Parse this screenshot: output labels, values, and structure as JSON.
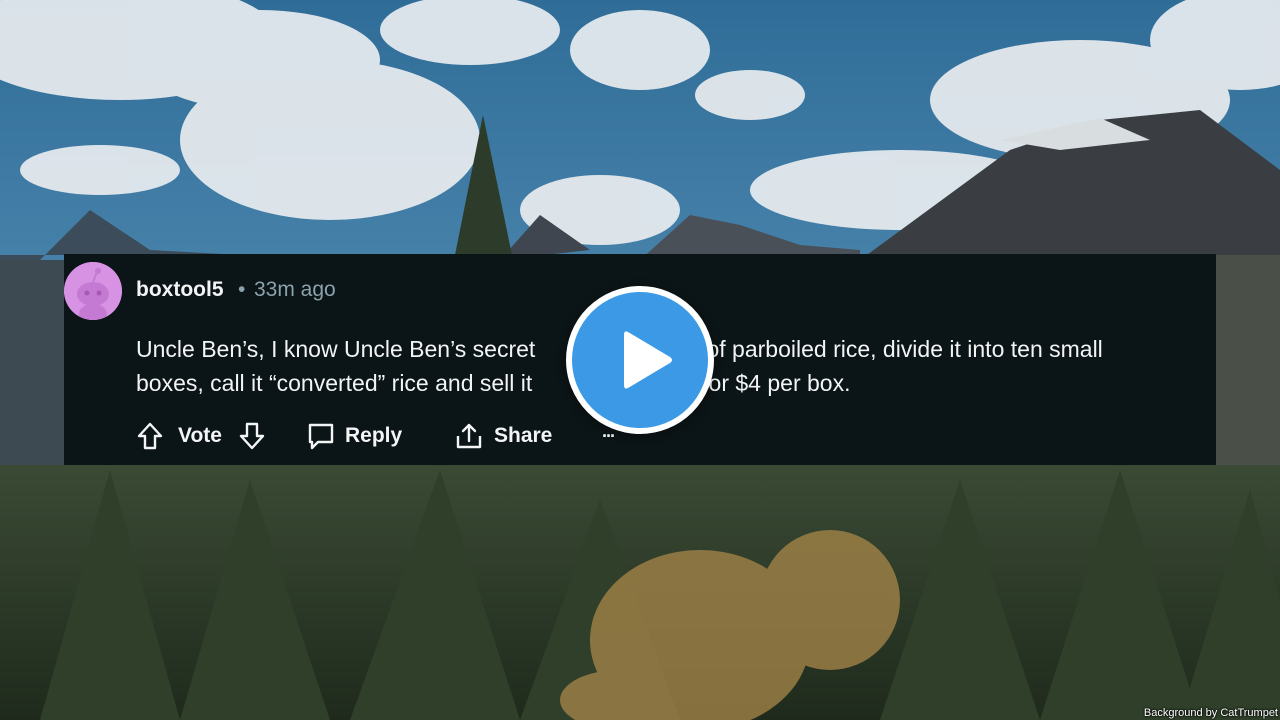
{
  "comment": {
    "username": "boxtool5",
    "separator": "•",
    "time_ago": "33m ago",
    "text_line1": "Uncle Ben’s, I know Uncle Ben’s secret",
    "text_line1_end": "g of parboiled rice, divide it into ten small",
    "text_line2": "boxes, call it “converted” rice and sell it",
    "text_line2_end": "ople for $4 per box.",
    "avatar_icon": "reddit-snoo-avatar"
  },
  "actions": {
    "vote_label": "Vote",
    "reply_label": "Reply",
    "share_label": "Share",
    "more_label": "···",
    "upvote_icon": "arrow-up-icon",
    "downvote_icon": "arrow-down-icon",
    "reply_icon": "speech-bubble-icon",
    "share_icon": "share-icon"
  },
  "player": {
    "play_icon": "play-icon",
    "accent_color": "#3c99e6"
  },
  "background": {
    "credit": "Background by CatTrumpet"
  }
}
